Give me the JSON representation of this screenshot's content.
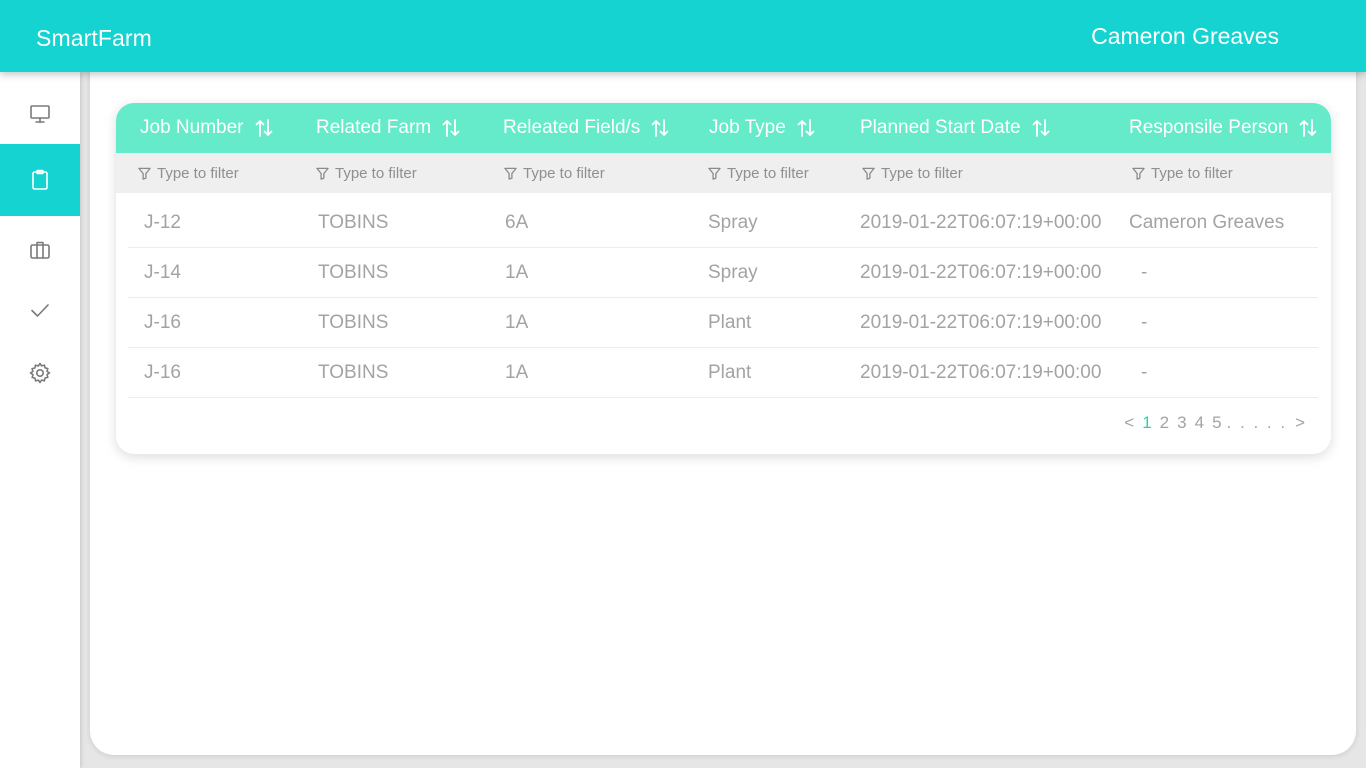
{
  "header": {
    "brand": "SmartFarm",
    "user_name": "Cameron Greaves"
  },
  "sidebar": {
    "items": [
      {
        "name": "monitor-icon",
        "active": false
      },
      {
        "name": "clipboard-icon",
        "active": true
      },
      {
        "name": "briefcase-icon",
        "active": false
      },
      {
        "name": "checkmark-icon",
        "active": false
      },
      {
        "name": "gear-icon",
        "active": false
      }
    ]
  },
  "table": {
    "columns": [
      {
        "label": "Job Number",
        "filter_placeholder": "Type to filter"
      },
      {
        "label": "Related Farm",
        "filter_placeholder": "Type to filter"
      },
      {
        "label": "Releated Field/s",
        "filter_placeholder": "Type to filter"
      },
      {
        "label": "Job Type",
        "filter_placeholder": "Type to filter"
      },
      {
        "label": "Planned Start Date",
        "filter_placeholder": "Type to filter"
      },
      {
        "label": "Responsile Person",
        "filter_placeholder": "Type to filter"
      }
    ],
    "rows": [
      [
        "J-12",
        "TOBINS",
        "6A",
        "Spray",
        "2019-01-22T06:07:19+00:00",
        "Cameron Greaves"
      ],
      [
        "J-14",
        "TOBINS",
        "1A",
        "Spray",
        "2019-01-22T06:07:19+00:00",
        "-"
      ],
      [
        "J-16",
        "TOBINS",
        "1A",
        "Plant",
        "2019-01-22T06:07:19+00:00",
        "-"
      ],
      [
        "J-16",
        "TOBINS",
        "1A",
        "Plant",
        "2019-01-22T06:07:19+00:00",
        "-"
      ]
    ]
  },
  "pagination": {
    "prev": "<",
    "pages": [
      "1",
      "2",
      "3",
      "4",
      "5"
    ],
    "current": "1",
    "ellipsis": ". . . . .",
    "next": ">"
  },
  "colors": {
    "topbar": "#14d3d1",
    "table_header": "#65ebc9",
    "active_page": "#2fcfa8"
  }
}
